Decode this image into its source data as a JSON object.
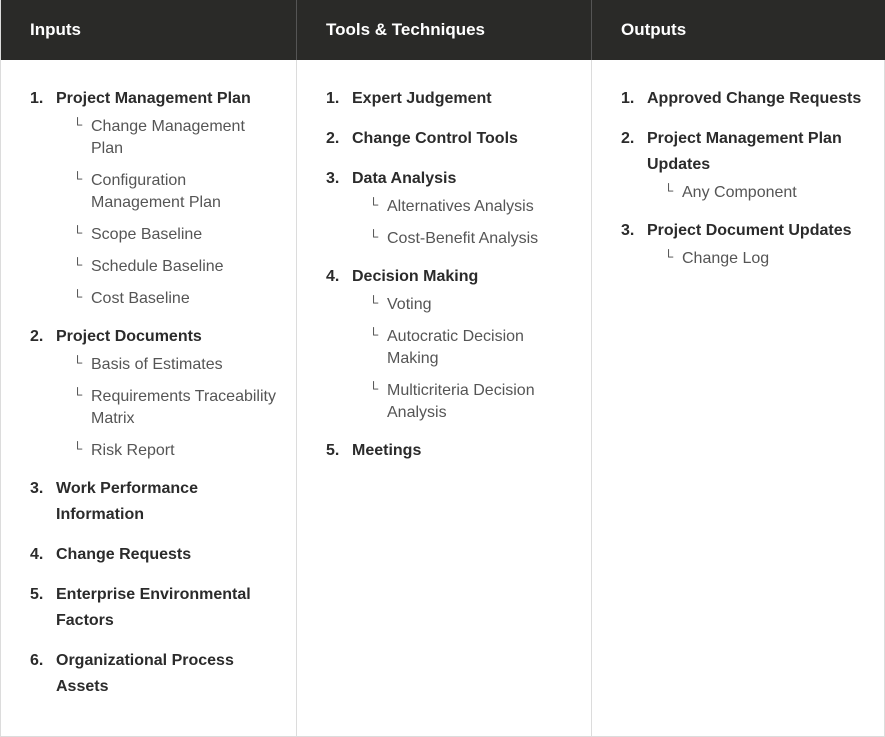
{
  "columns": [
    {
      "header": "Inputs",
      "items": [
        {
          "num": "1.",
          "label": "Project Management Plan",
          "sub": [
            "Change Management Plan",
            "Configuration Management Plan",
            "Scope Baseline",
            "Schedule Baseline",
            "Cost Baseline"
          ]
        },
        {
          "num": "2.",
          "label": "Project Documents",
          "sub": [
            "Basis of Estimates",
            "Requirements Traceability Matrix",
            "Risk Report"
          ]
        },
        {
          "num": "3.",
          "label": "Work Performance Information",
          "sub": []
        },
        {
          "num": "4.",
          "label": "Change Requests",
          "sub": []
        },
        {
          "num": "5.",
          "label": "Enterprise Environmental Factors",
          "sub": []
        },
        {
          "num": "6.",
          "label": "Organizational Process Assets",
          "sub": []
        }
      ]
    },
    {
      "header": "Tools & Techniques",
      "items": [
        {
          "num": "1.",
          "label": "Expert Judgement",
          "sub": []
        },
        {
          "num": "2.",
          "label": "Change Control Tools",
          "sub": []
        },
        {
          "num": "3.",
          "label": "Data Analysis",
          "sub": [
            "Alternatives Analysis",
            "Cost-Benefit Analysis"
          ]
        },
        {
          "num": "4.",
          "label": "Decision Making",
          "sub": [
            "Voting",
            "Autocratic Decision Making",
            "Multicriteria Decision Analysis"
          ]
        },
        {
          "num": "5.",
          "label": "Meetings",
          "sub": []
        }
      ]
    },
    {
      "header": "Outputs",
      "items": [
        {
          "num": "1.",
          "label": "Approved Change Requests",
          "sub": []
        },
        {
          "num": "2.",
          "label": "Project Management Plan Updates",
          "sub": [
            "Any Component"
          ]
        },
        {
          "num": "3.",
          "label": "Project Document Updates",
          "sub": [
            "Change Log"
          ]
        }
      ]
    }
  ],
  "icons": {
    "sub_item_marker": "corner-bullet-icon",
    "marker_glyph": "└"
  }
}
